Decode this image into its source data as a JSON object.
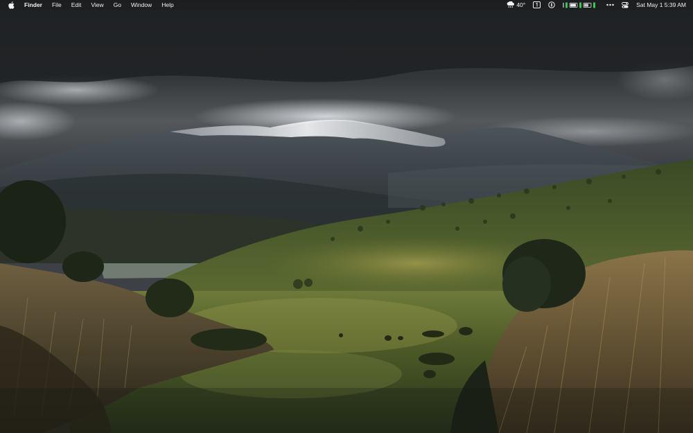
{
  "menubar": {
    "app_name": "Finder",
    "menus": [
      "File",
      "Edit",
      "View",
      "Go",
      "Window",
      "Help"
    ],
    "weather": {
      "icon": "cloud-rain-icon",
      "temperature": "40°"
    },
    "status_icons": [
      "calendar-day-icon",
      "password-icon",
      "battery-status-icon",
      "keyboard-icon",
      "more-icon",
      "control-center-icon"
    ],
    "datetime": "Sat May 1  5:39 AM"
  },
  "desktop": {
    "wallpaper": "mountain-valley-landscape"
  },
  "colors": {
    "menubar_bg": "#1c1c1e",
    "menubar_text": "#f2f2f2",
    "battery_green": "#35c759"
  }
}
